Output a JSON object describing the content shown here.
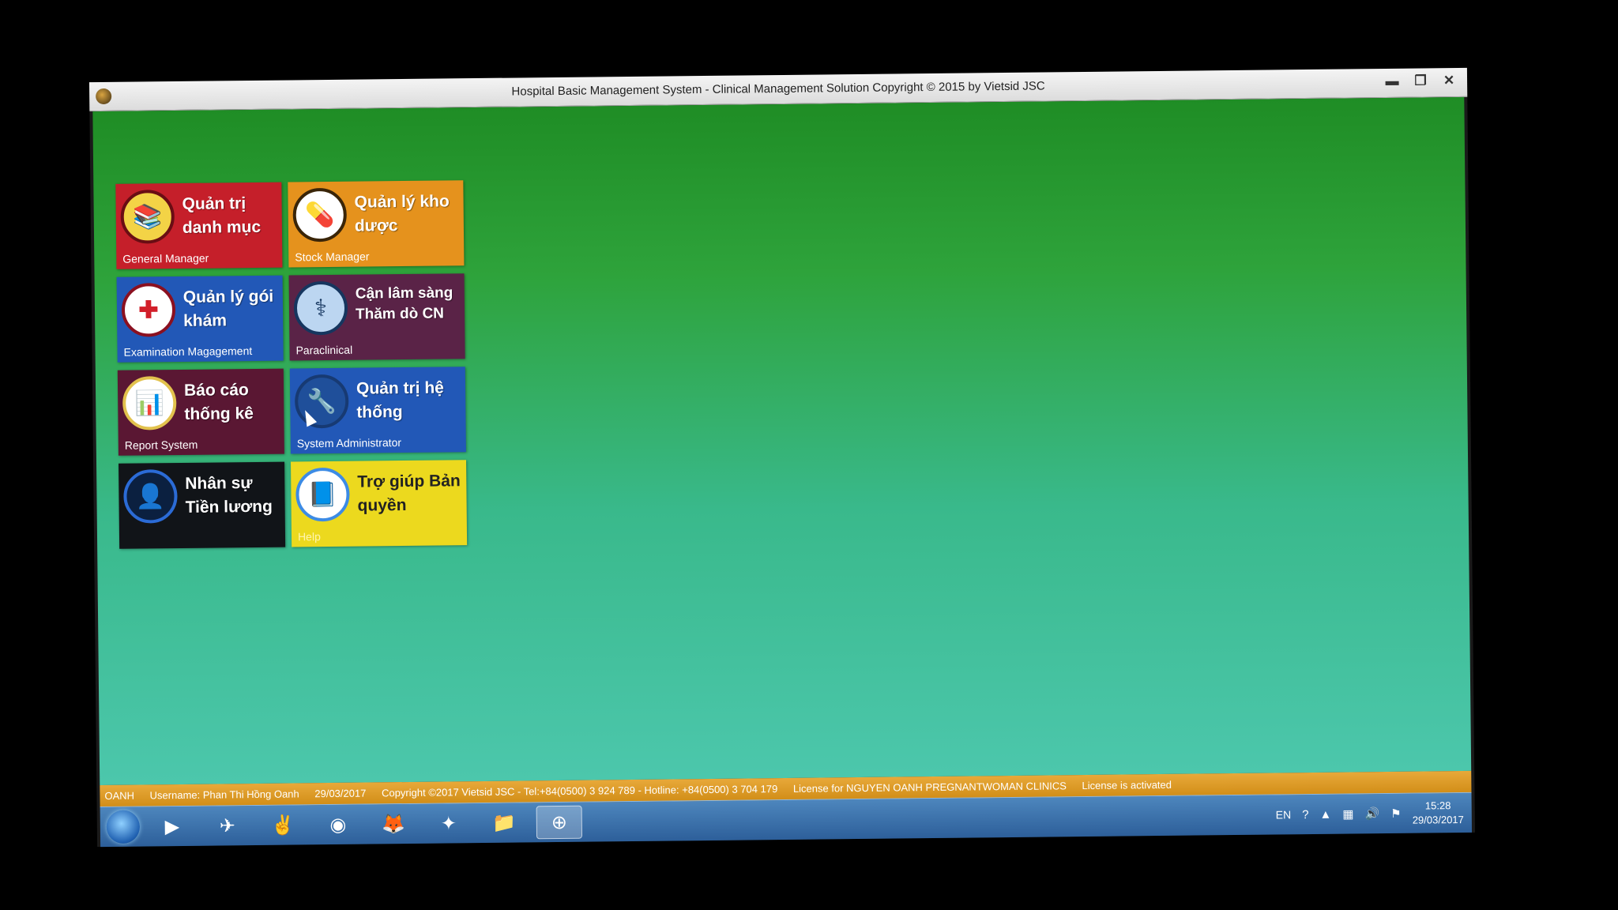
{
  "window": {
    "title": "Hospital Basic Management System - Clinical Management Solution Copyright © 2015  by Vietsid JSC",
    "minimize": "▬",
    "restore": "❐",
    "close": "✕"
  },
  "tiles": [
    {
      "id": "general",
      "title": "Quản trị danh mục",
      "subtitle": "General Manager",
      "icon": "catalog-icon",
      "glyph": "📚"
    },
    {
      "id": "stock",
      "title": "Quản lý kho dược",
      "subtitle": "Stock Manager",
      "icon": "pharmacy-stock-icon",
      "glyph": "💊"
    },
    {
      "id": "exam",
      "title": "Quản lý gói khám",
      "subtitle": "Examination Magagement",
      "icon": "medical-cross-icon",
      "glyph": "✚"
    },
    {
      "id": "para",
      "title": "Cận lâm sàng Thăm dò CN",
      "subtitle": "Paraclinical",
      "icon": "paraclinical-icon",
      "glyph": "⚕"
    },
    {
      "id": "report",
      "title": "Báo cáo thống kê",
      "subtitle": "Report System",
      "icon": "report-icon",
      "glyph": "📊"
    },
    {
      "id": "sysadm",
      "title": "Quản trị hệ thống",
      "subtitle": "System Administrator",
      "icon": "tools-icon",
      "glyph": "🔧"
    },
    {
      "id": "hr",
      "title": "Nhân sự Tiền lương",
      "subtitle": "",
      "icon": "person-icon",
      "glyph": "👤"
    },
    {
      "id": "help",
      "title": "Trợ giúp Bản quyền",
      "subtitle": "Help",
      "icon": "books-icon",
      "glyph": "📘"
    }
  ],
  "status": {
    "user_code": "OANH",
    "username": "Username: Phan Thi Hồng Oanh",
    "date": "29/03/2017",
    "copyright": "Copyright ©2017 Vietsid JSC - Tel:+84(0500) 3 924 789 - Hotline: +84(0500) 3 704 179",
    "license": "License for NGUYEN OANH PREGNANTWOMAN CLINICS",
    "license_state": "License is activated"
  },
  "taskbar": {
    "apps": [
      {
        "name": "media-player-icon",
        "glyph": "▶"
      },
      {
        "name": "network-icon",
        "glyph": "✈"
      },
      {
        "name": "utility-icon",
        "glyph": "✌"
      },
      {
        "name": "chrome-icon",
        "glyph": "◉"
      },
      {
        "name": "firefox-icon",
        "glyph": "🦊"
      },
      {
        "name": "tools-app-icon",
        "glyph": "✦"
      },
      {
        "name": "file-explorer-icon",
        "glyph": "📁"
      },
      {
        "name": "hospital-app-icon",
        "glyph": "⊕"
      }
    ],
    "language": "EN",
    "time": "15:28",
    "date": "29/03/2017"
  }
}
